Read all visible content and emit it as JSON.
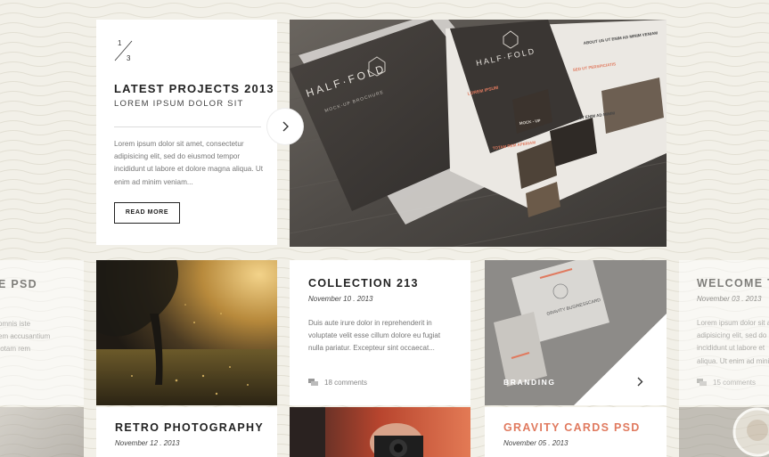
{
  "colors": {
    "background": "#f2f0e8",
    "card": "#ffffff",
    "text_dark": "#222222",
    "text_muted": "#777777",
    "accent_coral": "#e07a5f",
    "branding_overlay": "#8a8886"
  },
  "featured": {
    "pager_current": "1",
    "pager_total": "3",
    "title": "LATEST PROJECTS 2013",
    "subtitle": "LOREM IPSUM DOLOR SIT",
    "body": "Lorem ipsum dolor sit amet, consectetur adipisicing elit, sed do eiusmod tempor incididunt ut labore et dolore magna aliqua. Ut enim ad minim veniam...",
    "read_more_label": "READ MORE",
    "next_icon": "chevron-right-icon",
    "image_alt": "Half-fold brochure mockup on wooden table",
    "brochure_brand": "HALF·FOLD",
    "brochure_tagline": "MOCK-UP BROCHURE",
    "brochure_headings": [
      "ABOUT US UT ENIM AD MINIM VENIAM",
      "SED UT PERSPICIATIS",
      "UT ENIM AD MINIM",
      "MOCK - UP",
      "TOTAM REM APERIAM",
      "LOREM IPSUM"
    ]
  },
  "left_ghost": {
    "title_fragment": "E PSD",
    "body_lines": [
      "omnis iste",
      "em accusantium",
      "totam rem"
    ]
  },
  "right_ghost": {
    "title_fragment": "WELCOME T",
    "date": "November 03 . 2013",
    "body_lines": [
      "Lorem ipsum dolor sit a",
      "adipisicing elit, sed do",
      "incididunt ut labore et",
      "aliqua. Ut enim ad mini"
    ],
    "comments": "15 comments"
  },
  "retro_photo": {
    "image_alt": "Tree at sunset over a field"
  },
  "collection": {
    "title": "COLLECTION 213",
    "date": "November 10 . 2013",
    "body": "Duis aute irure dolor in reprehenderit in voluptate velit esse cillum dolore eu fugiat nulla pariatur. Excepteur sint occaecat...",
    "comments": "18 comments",
    "comment_icon": "speech-bubbles-icon"
  },
  "branding": {
    "label": "BRANDING",
    "card_text": "GRAVITY BUSINESSCARD",
    "next_icon": "chevron-right-icon"
  },
  "retro": {
    "title": "RETRO PHOTOGRAPHY",
    "date": "November 12 . 2013"
  },
  "gravity": {
    "title": "GRAVITY CARDS PSD",
    "date": "November 05 . 2013"
  }
}
